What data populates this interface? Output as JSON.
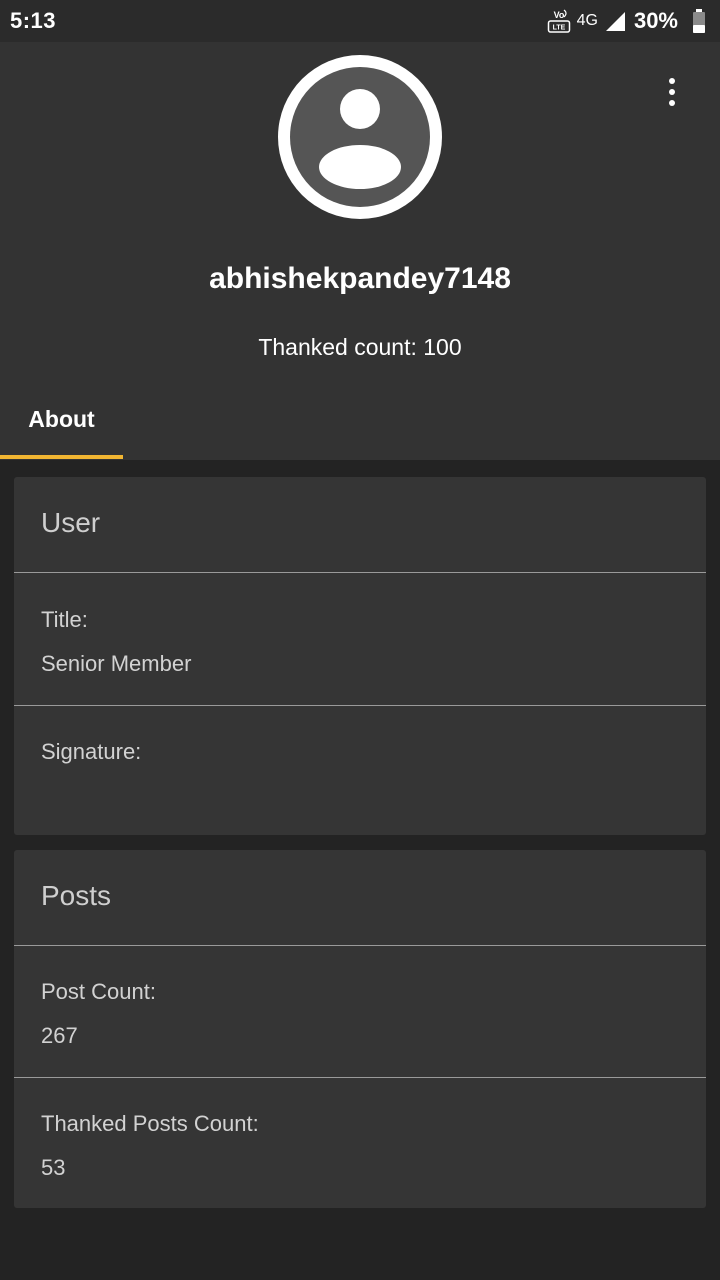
{
  "status_bar": {
    "time": "5:13",
    "network_type": "4G",
    "battery_percent": "30%",
    "volte_icon": "volte-lte-icon",
    "signal_icon": "signal-icon",
    "battery_icon": "battery-icon"
  },
  "profile": {
    "username": "abhishekpandey7148",
    "thanked_count": "Thanked count: 100",
    "avatar_icon": "default-avatar-icon",
    "menu_icon": "overflow-menu-icon"
  },
  "tabs": [
    {
      "label": "About",
      "selected": true
    }
  ],
  "colors": {
    "accent": "#f2b632",
    "header_bg": "#333333",
    "card_bg": "#353535",
    "page_bg": "#232323"
  },
  "user_card": {
    "title": "User",
    "fields": [
      {
        "label": "Title:",
        "value": "Senior Member"
      },
      {
        "label": "Signature:",
        "value": ""
      }
    ]
  },
  "posts_card": {
    "title": "Posts",
    "fields": [
      {
        "label": "Post Count:",
        "value": "267"
      },
      {
        "label": "Thanked Posts Count:",
        "value": "53"
      }
    ]
  }
}
